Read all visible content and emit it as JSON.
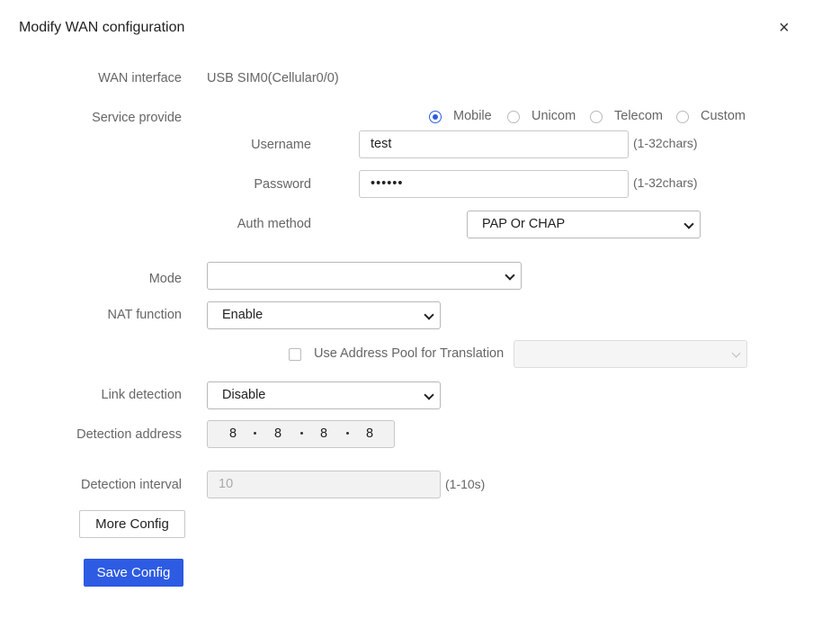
{
  "dialog": {
    "title": "Modify WAN configuration",
    "close_symbol": "×"
  },
  "wan_interface": {
    "label": "WAN interface",
    "value": "USB SIM0(Cellular0/0)"
  },
  "service_provider": {
    "label": "Service provide",
    "options": [
      {
        "label": "Mobile",
        "checked": true
      },
      {
        "label": "Unicom",
        "checked": false
      },
      {
        "label": "Telecom",
        "checked": false
      },
      {
        "label": "Custom",
        "checked": false
      }
    ]
  },
  "username": {
    "label": "Username",
    "value": "test",
    "hint": "(1-32chars)"
  },
  "password": {
    "label": "Password",
    "value": "••••••",
    "hint": "(1-32chars)"
  },
  "auth_method": {
    "label": "Auth method",
    "value": "PAP Or CHAP"
  },
  "mode": {
    "label": "Mode",
    "value": ""
  },
  "nat_function": {
    "label": "NAT function",
    "value": "Enable"
  },
  "address_pool": {
    "label": "Use Address Pool for Translation",
    "checked": false,
    "value": ""
  },
  "link_detection": {
    "label": "Link detection",
    "value": "Disable"
  },
  "detection_address": {
    "label": "Detection address",
    "octets": [
      "8",
      "8",
      "8",
      "8"
    ]
  },
  "detection_interval": {
    "label": "Detection interval",
    "placeholder": "10",
    "hint": "(1-10s)"
  },
  "buttons": {
    "more_config": "More Config",
    "save_config": "Save Config"
  },
  "colors": {
    "primary": "#2d5be3",
    "label": "#666666",
    "border": "#c8c8c8"
  }
}
